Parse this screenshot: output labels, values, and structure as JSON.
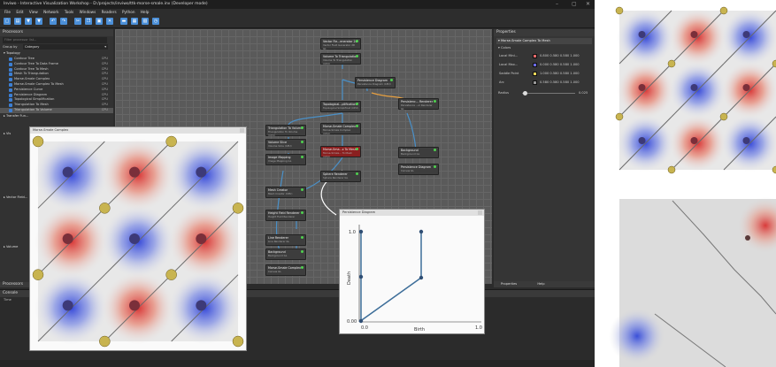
{
  "window": {
    "title": "Inviwo - Interactive Visualization Workshop - D:/projects/inviwo/ttk-morse-smale.inv (Developer mode)",
    "controls": [
      "–",
      "▢",
      "✕"
    ]
  },
  "menu": [
    "File",
    "Edit",
    "View",
    "Network",
    "Tools",
    "Windows",
    "Readers",
    "Python",
    "Help"
  ],
  "processors": {
    "title": "Processors",
    "filter_placeholder": "Filter processor list...",
    "group_by_label": "Group by",
    "group_by_value": "Category",
    "group": "Topology",
    "items": [
      {
        "label": "Contour Tree",
        "tag": "CPU"
      },
      {
        "label": "Contour Tree To Data Frame",
        "tag": "CPU"
      },
      {
        "label": "Contour Tree To Mesh",
        "tag": "CPU"
      },
      {
        "label": "Mesh To Triangulation",
        "tag": "CPU"
      },
      {
        "label": "Morse-Smale Complex",
        "tag": "CPU"
      },
      {
        "label": "Morse-Smale Complex To Mesh",
        "tag": "CPU"
      },
      {
        "label": "Persistence Curve",
        "tag": "CPU"
      },
      {
        "label": "Persistence Diagram",
        "tag": "CPU"
      },
      {
        "label": "Topological Simplification",
        "tag": "CPU"
      },
      {
        "label": "Triangulation To Mesh",
        "tag": "CPU"
      },
      {
        "label": "Triangulation To Volume",
        "tag": "CPU"
      }
    ],
    "more_groups": [
      "Transfer Fun...",
      "Vis",
      "Vector Field...",
      "Volume"
    ],
    "bottom_label": "Processors"
  },
  "network": {
    "nodes": [
      {
        "title": "Vector Fie...enerator 2D",
        "sub": "Vector Field Generator 2D GL"
      },
      {
        "title": "Volume To Triangulation",
        "sub": "Volume To Triangulation (CPU)"
      },
      {
        "title": "Persistence Diagram",
        "sub": "Persistence Diagram (CPU)"
      },
      {
        "title": "Topological...plification",
        "sub": "Topological Simplificat (CPU)"
      },
      {
        "title": "Persistenc... Renderer",
        "sub": "Persistence ...ol Renderer GL"
      },
      {
        "title": "Triangulation To Volume",
        "sub": "Triangulation To Volume (CPU)"
      },
      {
        "title": "Morse-Smale Complex",
        "sub": "Morse-Smale Complex (CPU)"
      },
      {
        "title": "Volume Slice",
        "sub": "Volume Slice (CPU)"
      },
      {
        "title": "Morse-Sma...x To Mesh",
        "sub": "Morse-Smale... To Mesh (CPU)"
      },
      {
        "title": "Background",
        "sub": "Background GL"
      },
      {
        "title": "Image Mapping",
        "sub": "Image Mapping GL"
      },
      {
        "title": "Persistence Diagram",
        "sub": "Canvas GL"
      },
      {
        "title": "Sphere Renderer",
        "sub": "Sphere Renderer GL"
      },
      {
        "title": "Mesh Creator",
        "sub": "Mesh Creator (CPU)"
      },
      {
        "title": "Height Field Renderer",
        "sub": "Height Field Renderer"
      },
      {
        "title": "Line Renderer",
        "sub": "Line Renderer GL"
      },
      {
        "title": "Background",
        "sub": "Background GL"
      },
      {
        "title": "Morse-Smale Complex",
        "sub": "Canvas GL"
      }
    ]
  },
  "properties": {
    "title": "Properties",
    "processor": "Morse-Smale Complex To Mesh",
    "section": "Colors",
    "rows": [
      {
        "label": "Local Mini...",
        "value": "0.800 0.580 0.580 1.000",
        "color": "#e86a6a"
      },
      {
        "label": "Local Max...",
        "value": "0.000 0.580 0.580 1.000",
        "color": "#6a6ae8"
      },
      {
        "label": "Saddle Point",
        "value": "1.000 0.580 0.580 1.000",
        "color": "#f0d85a"
      },
      {
        "label": "Arc",
        "value": "0.580 0.580 0.580 1.000",
        "color": "#999999"
      }
    ],
    "radius_label": "Radius",
    "radius_value": "0.025",
    "radius_fraction": 0.05,
    "tabs": [
      "Properties",
      "Help"
    ]
  },
  "console": {
    "title": "Console",
    "header": "Time"
  },
  "statusbar": {
    "text": "",
    "right": ""
  },
  "canvas_msc": {
    "title": "Morse-Smale Complex"
  },
  "persistence": {
    "title": "Persistence Diagram",
    "xlabel": "Birth",
    "ylabel": "Death",
    "ticks_x": [
      "0.0",
      "1.0"
    ],
    "ticks_y": [
      "0.00",
      "1.0"
    ]
  }
}
